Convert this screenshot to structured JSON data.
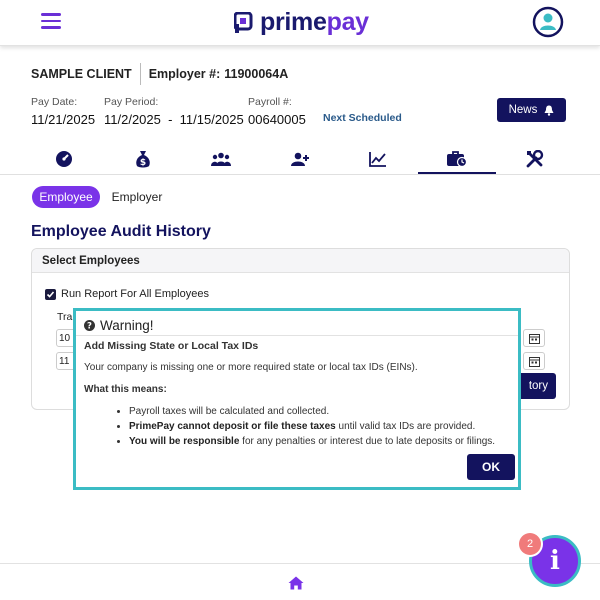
{
  "header": {
    "logo_prefix": "prime",
    "logo_suffix": "pay"
  },
  "client": {
    "name": "SAMPLE CLIENT",
    "employer_label": "Employer #:",
    "employer_number": "11900064A"
  },
  "pay": {
    "date_label": "Pay Date:",
    "date_value": "11/21/2025",
    "period_label": "Pay Period:",
    "period_value": "11/2/2025  -  11/15/2025",
    "payroll_label": "Payroll #:",
    "payroll_value": "00640005",
    "next_scheduled": "Next Scheduled"
  },
  "news_button": {
    "label": "News"
  },
  "nav_tabs": [
    {
      "icon": "dashboard-icon",
      "active": false
    },
    {
      "icon": "money-bag-icon",
      "active": false
    },
    {
      "icon": "people-icon",
      "active": false
    },
    {
      "icon": "add-user-icon",
      "active": false
    },
    {
      "icon": "chart-icon",
      "active": false
    },
    {
      "icon": "briefcase-icon",
      "active": true
    },
    {
      "icon": "tools-icon",
      "active": false
    }
  ],
  "segments": {
    "employee": "Employee",
    "employer": "Employer"
  },
  "page_title": "Employee Audit History",
  "card": {
    "header": "Select Employees",
    "run_report_label": "Run Report For All Employees",
    "partial_label": "Tra",
    "field1_value": "10",
    "field2_value": "11",
    "history_button_label": "tory"
  },
  "modal": {
    "title": "Warning!",
    "subtitle": "Add Missing State or Local Tax IDs",
    "body": "Your company is missing one or more required state or local tax IDs (EINs).",
    "meaning_label": "What this means:",
    "bullets": [
      {
        "bold": "",
        "text": "Payroll taxes will be calculated and collected."
      },
      {
        "bold": "PrimePay cannot deposit or file these taxes",
        "text": " until valid tax IDs are provided."
      },
      {
        "bold": "You will be responsible",
        "text": " for any penalties or interest due to late deposits or filings."
      }
    ],
    "ok_label": "OK"
  },
  "fab": {
    "badge_count": "2",
    "letter": "i"
  },
  "colors": {
    "brand_navy": "#13135e",
    "accent_purple": "#7a33e8",
    "modal_border": "#3bbcc4"
  }
}
